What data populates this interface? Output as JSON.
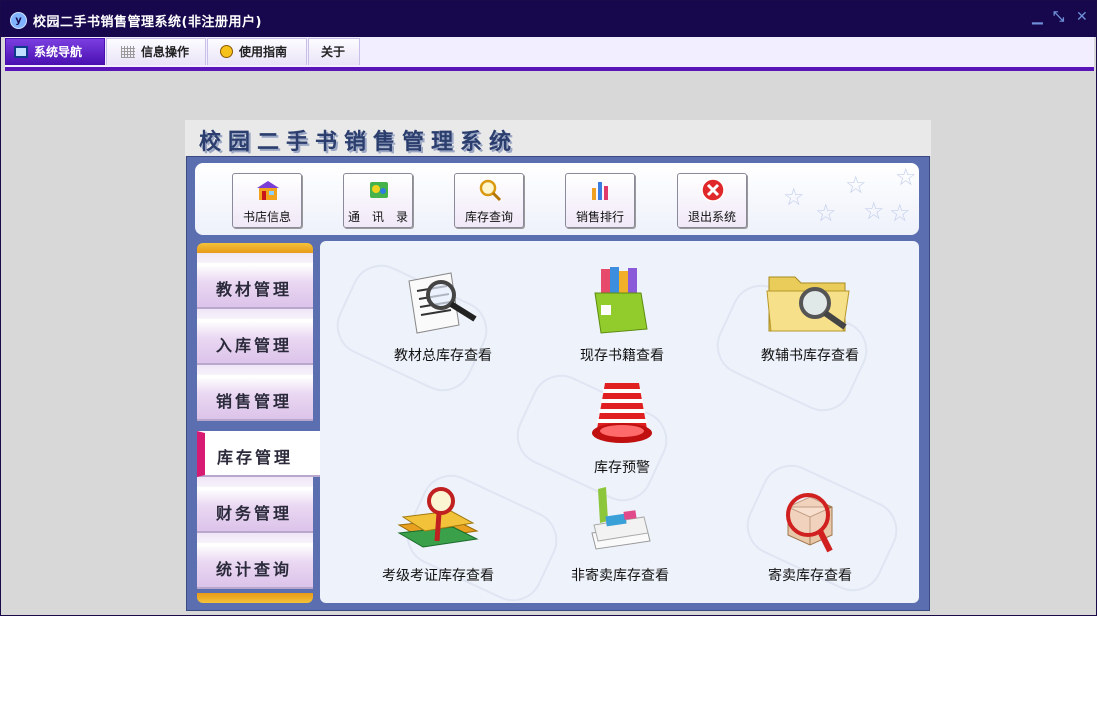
{
  "window": {
    "title": "校园二手书销售管理系统(非注册用户)"
  },
  "menu": {
    "tabs": [
      {
        "label": "系统导航",
        "active": true
      },
      {
        "label": "信息操作"
      },
      {
        "label": "使用指南"
      },
      {
        "label": "关于"
      }
    ]
  },
  "panel": {
    "title": "校园二手书销售管理系统"
  },
  "toolbar": {
    "buttons": [
      {
        "label": "书店信息",
        "icon": "shop-icon"
      },
      {
        "label": "通　讯　录",
        "icon": "address-book-icon"
      },
      {
        "label": "库存查询",
        "icon": "magnifier-icon"
      },
      {
        "label": "销售排行",
        "icon": "bar-chart-icon"
      },
      {
        "label": "退出系统",
        "icon": "exit-icon"
      }
    ]
  },
  "sidebar": {
    "items": [
      {
        "label": "教材管理"
      },
      {
        "label": "入库管理"
      },
      {
        "label": "销售管理"
      },
      {
        "label": "库存管理",
        "active": true
      },
      {
        "label": "财务管理"
      },
      {
        "label": "统计查询"
      }
    ]
  },
  "content": {
    "items": [
      {
        "label": "教材总库存查看",
        "icon": "document-search-icon"
      },
      {
        "label": "现存书籍查看",
        "icon": "book-box-icon"
      },
      {
        "label": "教辅书库存查看",
        "icon": "folder-search-icon"
      },
      {
        "label": "库存预警",
        "icon": "alarm-bell-icon"
      },
      {
        "label": "考级考证库存查看",
        "icon": "books-search-icon"
      },
      {
        "label": "非寄卖库存查看",
        "icon": "folder-books-icon"
      },
      {
        "label": "寄卖库存查看",
        "icon": "package-search-icon"
      }
    ]
  },
  "colors": {
    "titlebar": "#17084d",
    "accent": "#5a15b8",
    "panel": "#5b6fb0",
    "active_marker": "#d81b72"
  }
}
